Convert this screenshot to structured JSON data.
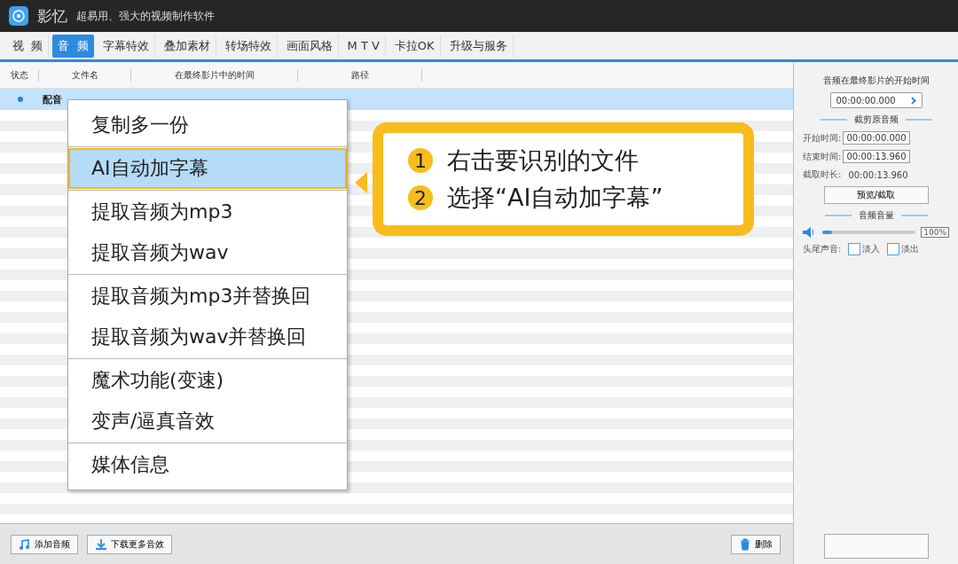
{
  "app": {
    "name": "影忆",
    "tagline": "超易用、强大的视频制作软件"
  },
  "tabs": [
    {
      "label": "视  频",
      "selected": false
    },
    {
      "label": "音  频",
      "selected": true
    },
    {
      "label": "字幕特效",
      "selected": false
    },
    {
      "label": "叠加素材",
      "selected": false
    },
    {
      "label": "转场特效",
      "selected": false
    },
    {
      "label": "画面风格",
      "selected": false
    },
    {
      "label": "M T V",
      "selected": false
    },
    {
      "label": "卡拉OK",
      "selected": false
    },
    {
      "label": "升级与服务",
      "selected": false
    }
  ],
  "table": {
    "columns": [
      "状态",
      "文件名",
      "在最终影片中的时间",
      "路径"
    ],
    "rows": [
      {
        "name": "配音",
        "selected": true
      }
    ]
  },
  "context_menu": {
    "groups": [
      [
        {
          "label": "复制多一份",
          "selected": false
        }
      ],
      [
        {
          "label": "AI自动加字幕",
          "selected": true
        }
      ],
      [
        {
          "label": "提取音频为mp3",
          "selected": false
        },
        {
          "label": "提取音频为wav",
          "selected": false
        }
      ],
      [
        {
          "label": "提取音频为mp3并替换回",
          "selected": false
        },
        {
          "label": "提取音频为wav并替换回",
          "selected": false
        }
      ],
      [
        {
          "label": "魔术功能(变速)",
          "selected": false
        },
        {
          "label": "变声/逼真音效",
          "selected": false
        }
      ],
      [
        {
          "label": "媒体信息",
          "selected": false
        }
      ]
    ]
  },
  "callout": {
    "steps": [
      {
        "number": "1",
        "text": "右击要识别的文件"
      },
      {
        "number": "2",
        "text": "选择“AI自动加字幕”"
      }
    ]
  },
  "side_panel": {
    "start_title": "音频在最终影片的开始时间",
    "start_time": "00:00:00.000",
    "trim_title": "截剪原音频",
    "start_label": "开始时间:",
    "start_value": "00:00:00.000",
    "end_label": "结束时间:",
    "end_value": "00:00:13.960",
    "duration_label": "截取时长:",
    "duration_value": "00:00:13.960",
    "preview_button": "预览/截取",
    "volume_title": "音频音量",
    "volume": {
      "level": 0.1
    },
    "volume_reading": "100%",
    "fade_label": "头尾声音:",
    "fades": [
      {
        "label": "淡入",
        "checked": false
      },
      {
        "label": "淡出",
        "checked": false
      }
    ]
  },
  "bottom_bar": {
    "add_button": "添加音频",
    "download_button": "下载更多音效",
    "delete_button": "删除"
  }
}
